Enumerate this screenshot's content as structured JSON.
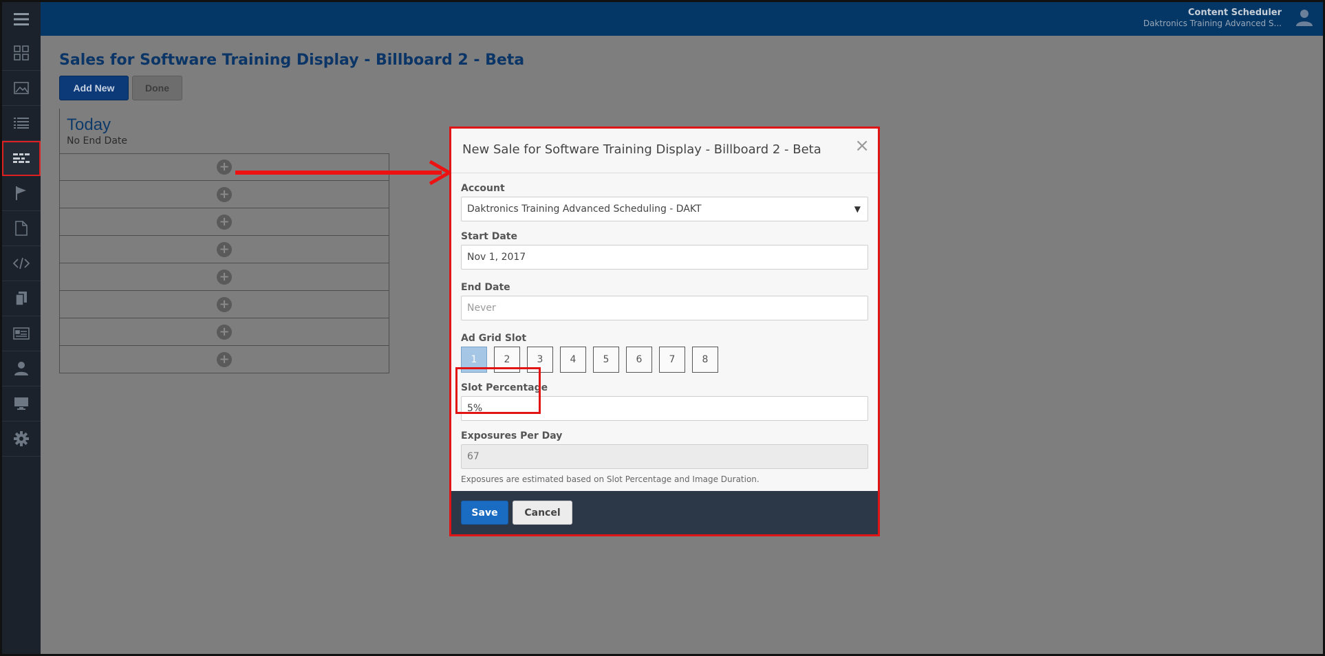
{
  "topbar": {
    "app_title": "Content Scheduler",
    "account_subtitle": "Daktronics Training Advanced S..."
  },
  "sidebar": {
    "items": [
      {
        "icon": "dashboard-icon"
      },
      {
        "icon": "image-icon"
      },
      {
        "icon": "list-icon"
      },
      {
        "icon": "ad-grid-icon",
        "active": true
      },
      {
        "icon": "flag-icon"
      },
      {
        "icon": "document-icon"
      },
      {
        "icon": "code-icon"
      },
      {
        "icon": "copy-icon"
      },
      {
        "icon": "card-icon"
      },
      {
        "icon": "user-icon"
      },
      {
        "icon": "monitor-icon"
      },
      {
        "icon": "settings-icon"
      }
    ]
  },
  "page": {
    "title": "Sales for Software Training Display - Billboard 2 - Beta",
    "add_new_label": "Add New",
    "done_label": "Done",
    "schedule": {
      "heading": "Today",
      "subheading": "No End Date",
      "slot_count": 8
    }
  },
  "modal": {
    "title": "New Sale for Software Training Display - Billboard 2 - Beta",
    "close_glyph": "×",
    "account_label": "Account",
    "account_value": "Daktronics Training Advanced Scheduling - DAKT",
    "start_date_label": "Start Date",
    "start_date_value": "Nov 1, 2017",
    "end_date_label": "End Date",
    "end_date_placeholder": "Never",
    "ad_grid_slot_label": "Ad Grid Slot",
    "slots": [
      "1",
      "2",
      "3",
      "4",
      "5",
      "6",
      "7",
      "8"
    ],
    "selected_slot": "1",
    "slot_percentage_label": "Slot Percentage",
    "slot_percentage_value": "5%",
    "exposures_label": "Exposures Per Day",
    "exposures_value": "67",
    "help_text": "Exposures are estimated based on Slot Percentage and Image Duration.",
    "save_label": "Save",
    "cancel_label": "Cancel"
  },
  "colors": {
    "topbar": "#053766",
    "sidebar": "#1b222c",
    "annotation": "#e01414",
    "primary_button": "#1a6bc2"
  }
}
